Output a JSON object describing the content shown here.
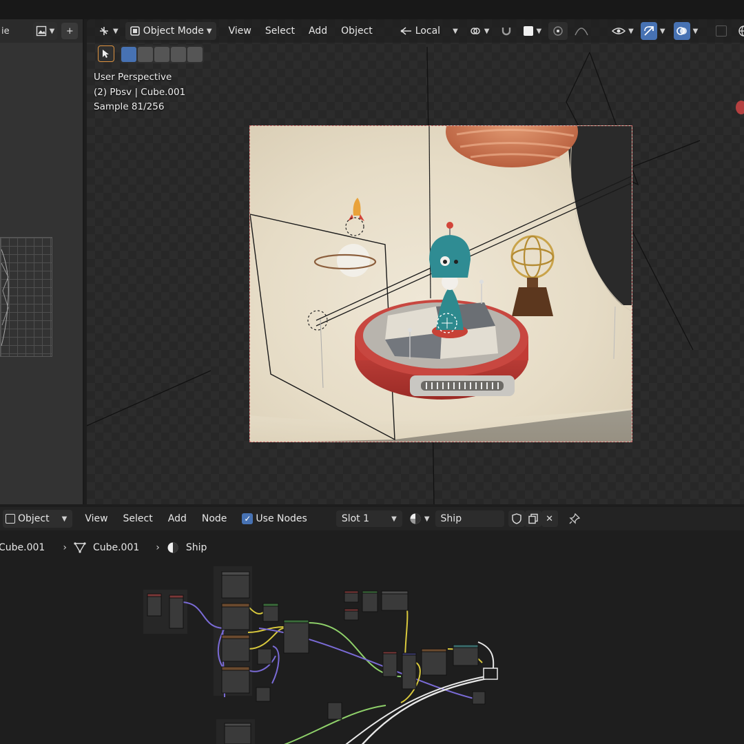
{
  "left_editor": {
    "title_fragment": "ie"
  },
  "viewport": {
    "mode": "Object Mode",
    "menus": [
      "View",
      "Select",
      "Add",
      "Object"
    ],
    "orientation": "Local",
    "info": {
      "line1": "User Perspective",
      "line2": "(2) Pbsv | Cube.001",
      "line3": "Sample 81/256"
    }
  },
  "node_editor": {
    "editor_type": "Object",
    "menus": [
      "View",
      "Select",
      "Add",
      "Node"
    ],
    "use_nodes_label": "Use Nodes",
    "slot": "Slot 1",
    "material": "Ship",
    "breadcrumb": [
      "Cube.001",
      "Cube.001",
      "Ship"
    ]
  },
  "colors": {
    "accent": "#4772b3",
    "bg": "#1d1d1d",
    "wire_purple": "#7a6bd6",
    "wire_green": "#8fd16a",
    "wire_yellow": "#d9c93d",
    "wire_white": "#e8e8e8"
  }
}
